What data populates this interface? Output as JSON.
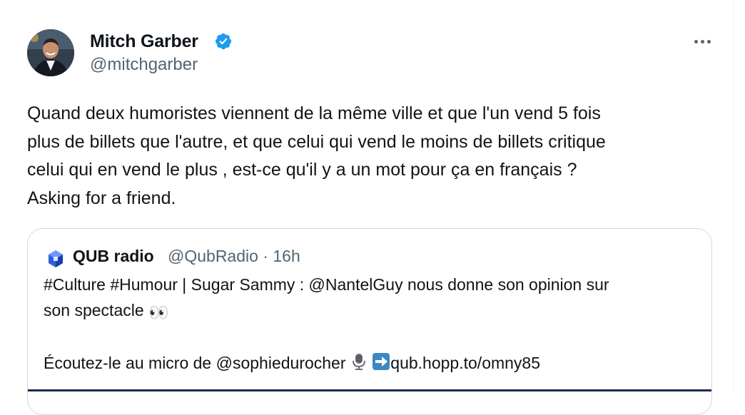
{
  "tweet": {
    "author_name": "Mitch Garber",
    "author_handle": "@mitchgarber",
    "text": "Quand deux humoristes viennent de la même ville et que l'un vend 5 fois\nplus de billets que l'autre, et que celui qui vend le moins de billets critique\ncelui qui en vend le plus , est-ce qu'il y a un mot pour ça en français ?\nAsking for a friend.",
    "verified_icon": "verified-badge-icon",
    "more_icon": "more-options-icon"
  },
  "quote": {
    "account_name": "QUB radio",
    "account_handle": "@QubRadio",
    "time_meta": "@QubRadio · 16h",
    "line1": "#Culture #Humour | Sugar Sammy : @NantelGuy nous donne son opinion sur",
    "line2_text": "son spectacle ",
    "line2_emoji": "👀",
    "line4_text": "Écoutez-le au micro de @sophiedurocher ",
    "line4_link": "qub.hopp.to/omny85",
    "logo_icon": "qub-logo-icon"
  },
  "colors": {
    "text": "#0f1419",
    "secondary": "#536471",
    "verified": "#1d9bf0",
    "border": "#cfd9de"
  }
}
